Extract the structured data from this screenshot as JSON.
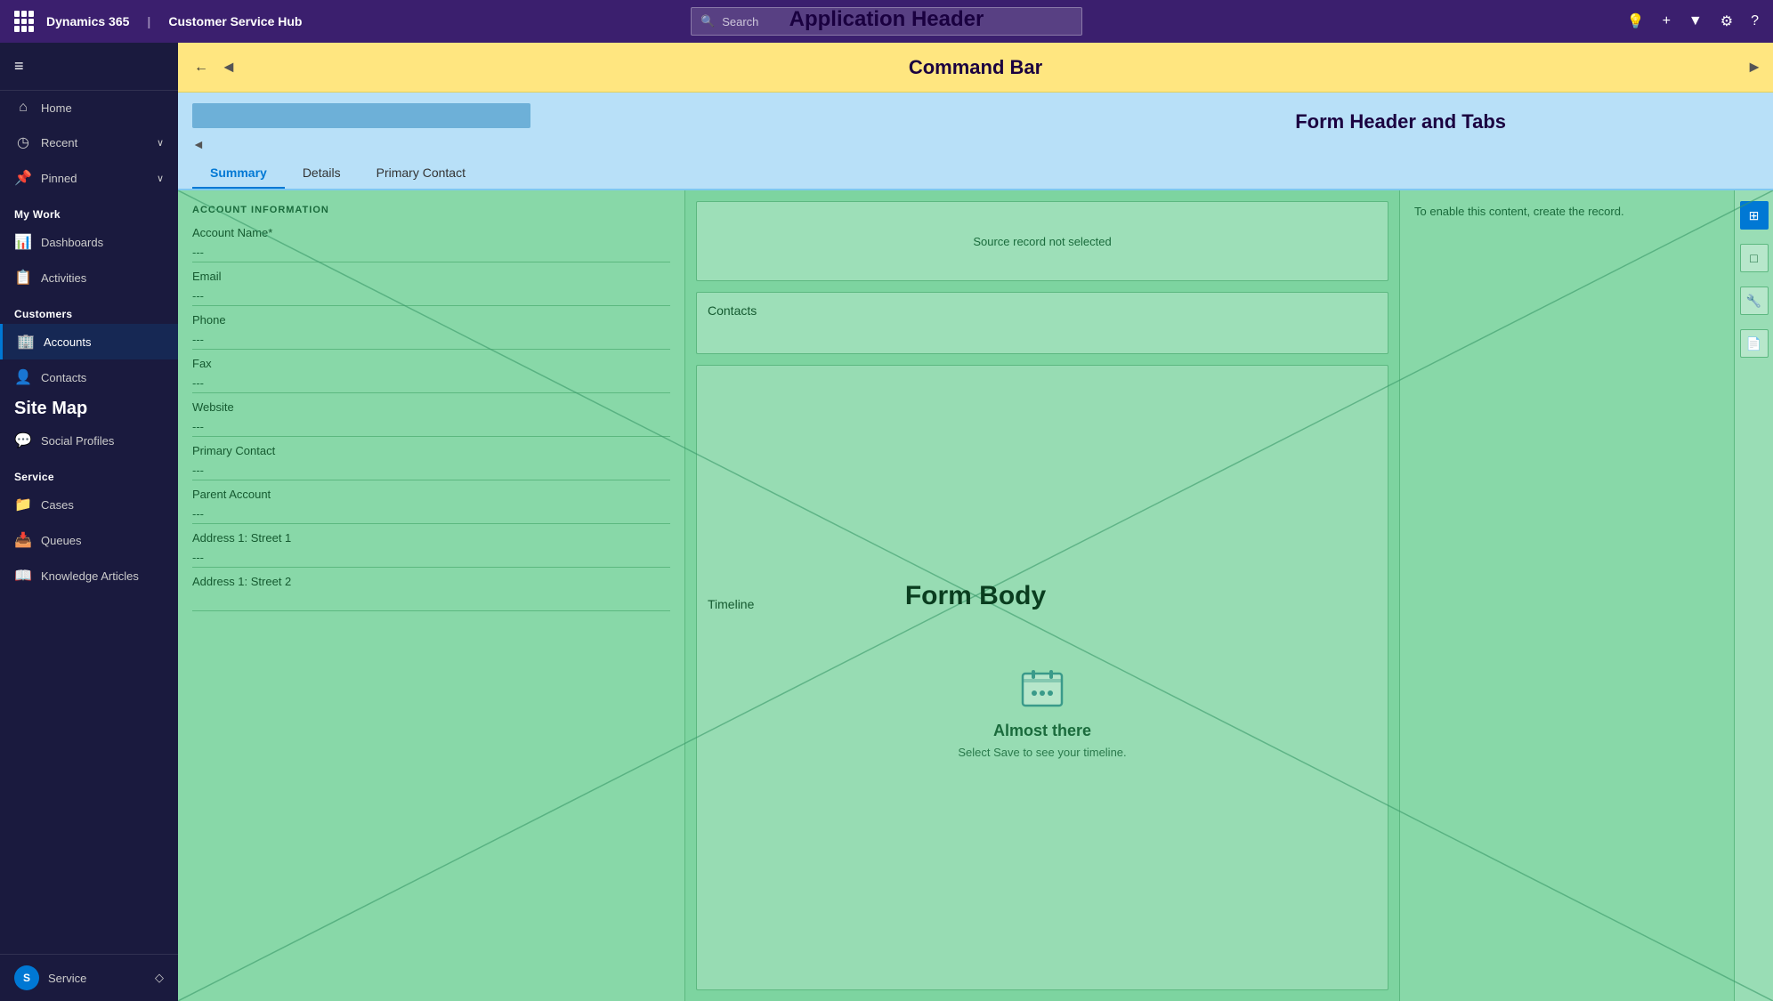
{
  "appHeader": {
    "logo": "⬡",
    "appName": "Dynamics 365",
    "divider": "|",
    "hubName": "Customer Service Hub",
    "searchPlaceholder": "Search",
    "label": "Application Header",
    "icons": [
      "💡",
      "+",
      "▼",
      "⚙",
      "?"
    ]
  },
  "commandBar": {
    "label": "Command Bar",
    "backIcon": "←",
    "arrowLeft": "◄",
    "arrowRight": "►"
  },
  "formHeader": {
    "label": "Form Header and Tabs",
    "arrowLeft": "◄",
    "arrowRight": "►",
    "tabs": [
      "Summary",
      "Details",
      "Primary Contact"
    ],
    "activeTab": 0
  },
  "sidebar": {
    "hamburger": "≡",
    "navItems": [
      {
        "icon": "⌂",
        "label": "Home",
        "expandable": false
      },
      {
        "icon": "◷",
        "label": "Recent",
        "expandable": true
      },
      {
        "icon": "📌",
        "label": "Pinned",
        "expandable": true
      }
    ],
    "myWork": {
      "label": "My Work",
      "items": [
        {
          "icon": "📊",
          "label": "Dashboards"
        },
        {
          "icon": "📋",
          "label": "Activities"
        }
      ]
    },
    "customers": {
      "label": "Customers",
      "items": [
        {
          "icon": "🏢",
          "label": "Accounts",
          "active": true
        },
        {
          "icon": "👤",
          "label": "Contacts"
        },
        {
          "icon": "💬",
          "label": "Social Profiles"
        }
      ]
    },
    "siteMapLabel": "Site Map",
    "service": {
      "label": "Service",
      "items": [
        {
          "icon": "📁",
          "label": "Cases"
        },
        {
          "icon": "📥",
          "label": "Queues"
        },
        {
          "icon": "📖",
          "label": "Knowledge Articles"
        }
      ]
    },
    "bottom": {
      "avatarText": "S",
      "label": "Service",
      "expandIcon": "◇"
    }
  },
  "formBody": {
    "label": "Form Body",
    "leftSection": {
      "sectionTitle": "ACCOUNT INFORMATION",
      "fields": [
        {
          "label": "Account Name*",
          "value": "---"
        },
        {
          "label": "Email",
          "value": "---"
        },
        {
          "label": "Phone",
          "value": "---"
        },
        {
          "label": "Fax",
          "value": "---"
        },
        {
          "label": "Website",
          "value": "---"
        },
        {
          "label": "Primary Contact",
          "value": "---"
        },
        {
          "label": "Parent Account",
          "value": "---"
        },
        {
          "label": "Address 1: Street 1",
          "value": "---"
        },
        {
          "label": "Address 1: Street 2",
          "value": ""
        }
      ]
    },
    "middleSection": {
      "sourceRecord": "Source record not selected",
      "contacts": "Contacts",
      "timeline": {
        "title": "Timeline",
        "heading": "Almost there",
        "subtext": "Select Save to see your timeline."
      }
    },
    "rightSection": {
      "message": "To enable this content, create the record.",
      "panelIcons": [
        "▦",
        "☐",
        "🔧",
        "📄"
      ]
    }
  }
}
